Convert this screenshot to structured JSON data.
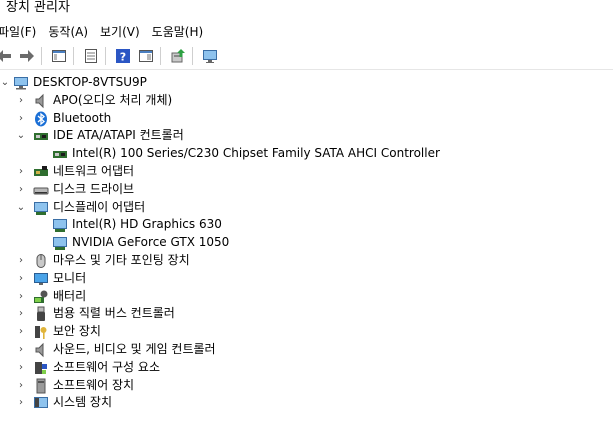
{
  "window": {
    "title": "장치 관리자"
  },
  "menu": {
    "items": [
      "파일(F)",
      "동작(A)",
      "보기(V)",
      "도움말(H)"
    ]
  },
  "toolbar": {
    "buttons": [
      "back-arrow-icon",
      "forward-arrow-icon",
      "show-hide-tree-icon",
      "properties-icon",
      "help-icon",
      "view-icon",
      "update-driver-icon",
      "monitor-scan-icon"
    ]
  },
  "tree": {
    "root": "DESKTOP-8VTSU9P",
    "items": [
      {
        "label": "APO(오디오 처리 개체)",
        "icon": "speaker-icon",
        "expanded": false
      },
      {
        "label": "Bluetooth",
        "icon": "bluetooth-icon",
        "expanded": false
      },
      {
        "label": "IDE ATA/ATAPI 컨트롤러",
        "icon": "ide-controller-icon",
        "expanded": true
      },
      {
        "label": "Intel(R) 100 Series/C230 Chipset Family SATA AHCI Controller",
        "icon": "ide-controller-icon",
        "child": true
      },
      {
        "label": "네트워크 어댑터",
        "icon": "network-adapter-icon",
        "expanded": false
      },
      {
        "label": "디스크 드라이브",
        "icon": "disk-drive-icon",
        "expanded": false
      },
      {
        "label": "디스플레이 어댑터",
        "icon": "display-adapter-icon",
        "expanded": true
      },
      {
        "label": "Intel(R) HD Graphics 630",
        "icon": "display-adapter-icon",
        "child": true
      },
      {
        "label": "NVIDIA GeForce GTX 1050",
        "icon": "display-adapter-icon",
        "child": true
      },
      {
        "label": "마우스 및 기타 포인팅 장치",
        "icon": "mouse-icon",
        "expanded": false
      },
      {
        "label": "모니터",
        "icon": "monitor-icon",
        "expanded": false
      },
      {
        "label": "배터리",
        "icon": "battery-icon",
        "expanded": false
      },
      {
        "label": "범용 직렬 버스 컨트롤러",
        "icon": "usb-icon",
        "expanded": false
      },
      {
        "label": "보안 장치",
        "icon": "security-key-icon",
        "expanded": false
      },
      {
        "label": "사운드, 비디오 및 게임 컨트롤러",
        "icon": "speaker-icon",
        "expanded": false
      },
      {
        "label": "소프트웨어 구성 요소",
        "icon": "software-component-icon",
        "expanded": false
      },
      {
        "label": "소프트웨어 장치",
        "icon": "software-device-icon",
        "expanded": false
      },
      {
        "label": "시스템 장치",
        "icon": "system-device-icon",
        "expanded": false
      }
    ]
  }
}
